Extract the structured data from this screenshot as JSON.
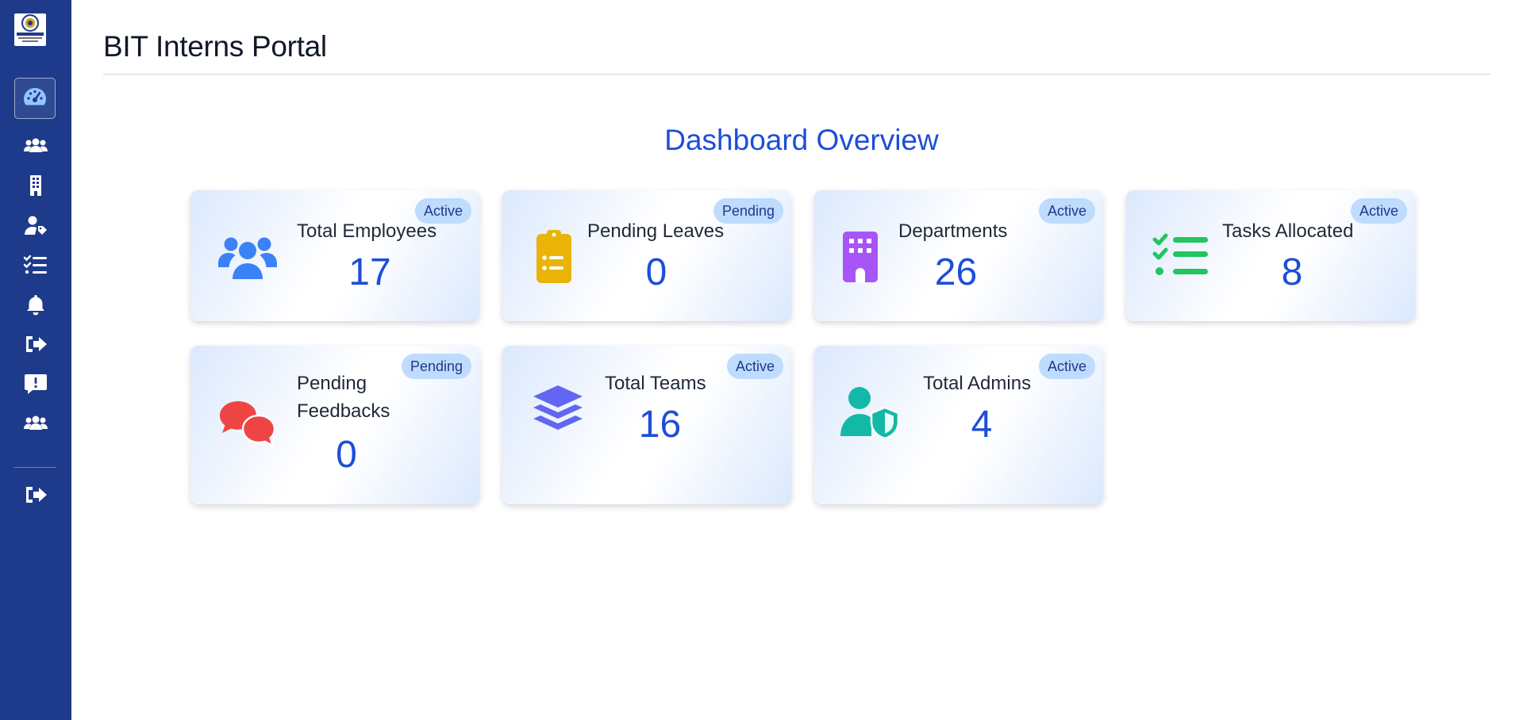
{
  "app": {
    "title": "BIT Interns Portal",
    "logo_icon": "college-seal-logo"
  },
  "sidebar": {
    "items": [
      {
        "icon": "dashboard-gauge-icon",
        "active": true
      },
      {
        "icon": "users-icon"
      },
      {
        "icon": "building-icon"
      },
      {
        "icon": "user-tag-icon"
      },
      {
        "icon": "task-list-icon"
      },
      {
        "icon": "bell-icon"
      },
      {
        "icon": "sign-out-icon"
      },
      {
        "icon": "feedback-alert-icon"
      },
      {
        "icon": "users-icon"
      },
      {
        "icon": "logout-icon"
      }
    ]
  },
  "main": {
    "section_title": "Dashboard Overview",
    "cards": [
      {
        "label": "Total Employees",
        "value": "17",
        "badge": "Active",
        "icon": "users-icon",
        "icon_color": "#3b82f6"
      },
      {
        "label": "Pending Leaves",
        "value": "0",
        "badge": "Pending",
        "icon": "clipboard-list-icon",
        "icon_color": "#eab308"
      },
      {
        "label": "Departments",
        "value": "26",
        "badge": "Active",
        "icon": "building-icon",
        "icon_color": "#a855f7"
      },
      {
        "label": "Tasks Allocated",
        "value": "8",
        "badge": "Active",
        "icon": "task-list-icon",
        "icon_color": "#22c55e"
      },
      {
        "label": "Pending Feedbacks",
        "label_line1": "Pending",
        "label_line2": "Feedbacks",
        "value": "0",
        "badge": "Pending",
        "icon": "comments-icon",
        "icon_color": "#ef4444"
      },
      {
        "label": "Total Teams",
        "value": "16",
        "badge": "Active",
        "icon": "layer-group-icon",
        "icon_color": "#6366f1"
      },
      {
        "label": "Total Admins",
        "value": "4",
        "badge": "Active",
        "icon": "user-shield-icon",
        "icon_color": "#14b8a6"
      }
    ]
  },
  "colors": {
    "sidebar_bg": "#1e3a8a",
    "accent": "#1d4ed8",
    "badge_bg": "#bfdbfe"
  }
}
